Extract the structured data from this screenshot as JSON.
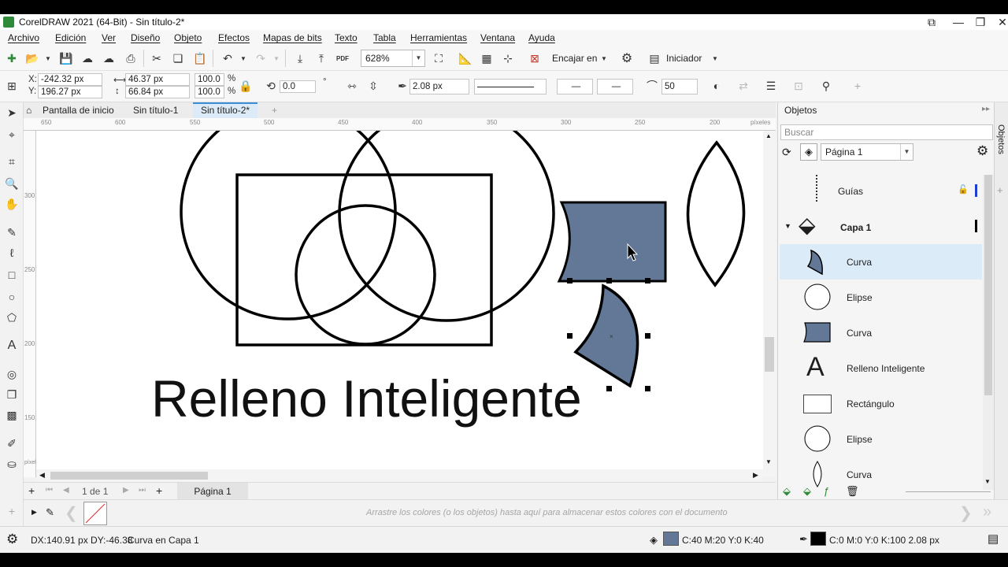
{
  "window": {
    "title": "CorelDRAW 2021 (64-Bit) - Sin título-2*",
    "controls": [
      "restore-down",
      "minimize",
      "maximize",
      "close"
    ]
  },
  "menu": [
    "Archivo",
    "Edición",
    "Ver",
    "Diseño",
    "Objeto",
    "Efectos",
    "Mapas de bits",
    "Texto",
    "Tabla",
    "Herramientas",
    "Ventana",
    "Ayuda"
  ],
  "toolbar": {
    "zoom": "628%",
    "snap_label": "Encajar en",
    "launcher_label": "Iniciador",
    "pdf_label": "PDF"
  },
  "property_bar": {
    "x_label": "X:",
    "x_value": "-242.32 px",
    "y_label": "Y:",
    "y_value": "196.27 px",
    "width_value": "46.37 px",
    "height_value": "66.84 px",
    "scale_w": "100.0",
    "scale_h": "100.0",
    "percent": "%",
    "rotation": "0.0",
    "outline_width": "2.08 px",
    "smoothing": "50"
  },
  "doc_tabs": [
    "Pantalla de inicio",
    "Sin título-1",
    "Sin título-2*"
  ],
  "ruler": {
    "h_ticks": [
      "650",
      "600",
      "550",
      "500",
      "450",
      "400",
      "350",
      "300",
      "250",
      "200"
    ],
    "h_unit": "píxeles",
    "v_ticks": [
      "300",
      "250",
      "200",
      "150"
    ],
    "v_unit": "píxeles"
  },
  "canvas": {
    "text_object": "Relleno Inteligente",
    "fill_color": "#627896"
  },
  "page_nav": {
    "counter": "1 de 1",
    "page_tab": "Página 1"
  },
  "palette": {
    "hint": "Arrastre los colores (o los objetos) hasta aquí para almacenar estos colores con el documento"
  },
  "status": {
    "delta": "DX:140.91 px DY:-46.38",
    "selection": "Curva en Capa 1",
    "fill_text": "C:40 M:20 Y:0 K:40",
    "outline_text": "C:0 M:0 Y:0 K:100  2.08 px"
  },
  "objects_docker": {
    "title": "Objetos",
    "search_placeholder": "Buscar",
    "page_select": "Página 1",
    "guides_label": "Guías",
    "layer_label": "Capa 1",
    "items": [
      "Curva",
      "Elipse",
      "Curva",
      "Relleno Inteligente",
      "Rectángulo",
      "Elipse",
      "Curva"
    ],
    "side_tab": "Objetos"
  }
}
